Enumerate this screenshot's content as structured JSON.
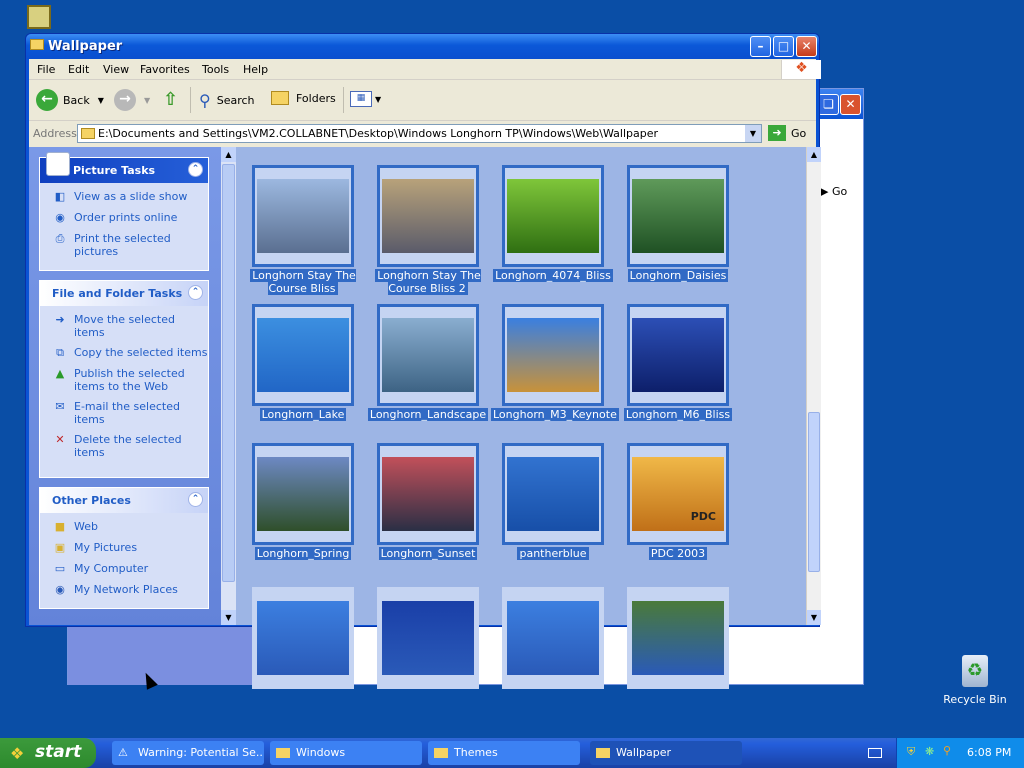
{
  "window": {
    "title": "Wallpaper"
  },
  "menu": [
    "File",
    "Edit",
    "View",
    "Favorites",
    "Tools",
    "Help"
  ],
  "toolbar": {
    "back": "Back",
    "search": "Search",
    "folders": "Folders"
  },
  "address": {
    "label": "Address",
    "value": "E:\\Documents and Settings\\VM2.COLLABNET\\Desktop\\Windows Longhorn TP\\Windows\\Web\\Wallpaper",
    "go": "Go"
  },
  "picture_tasks": {
    "title": "Picture Tasks",
    "items": [
      "View as a slide show",
      "Order prints online",
      "Print the selected pictures"
    ]
  },
  "file_tasks": {
    "title": "File and Folder Tasks",
    "items": [
      "Move the selected items",
      "Copy the selected items",
      "Publish the selected items to the Web",
      "E-mail the selected items",
      "Delete the selected items"
    ]
  },
  "other_places": {
    "title": "Other Places",
    "items": [
      "Web",
      "My Pictures",
      "My Computer",
      "My Network Places"
    ]
  },
  "files": [
    {
      "name": "Longhorn Stay The Course Bliss",
      "colors": [
        "#9cb8e0",
        "#5a6f90"
      ]
    },
    {
      "name": "Longhorn Stay The Course Bliss 2",
      "colors": [
        "#b8a27a",
        "#5a5b6a"
      ]
    },
    {
      "name": "Longhorn_4074_Bliss",
      "colors": [
        "#7fc63a",
        "#2f6f12"
      ]
    },
    {
      "name": "Longhorn_Daisies",
      "colors": [
        "#5f9a5a",
        "#1f5124"
      ]
    },
    {
      "name": "Longhorn_Lake",
      "colors": [
        "#3c8fe0",
        "#2166c6"
      ]
    },
    {
      "name": "Longhorn_Landscape",
      "colors": [
        "#8aaed0",
        "#3d6384"
      ]
    },
    {
      "name": "Longhorn_M3_Keynote",
      "colors": [
        "#3a7fe0",
        "#c8923a"
      ]
    },
    {
      "name": "Longhorn_M6_Bliss",
      "colors": [
        "#2c4fb6",
        "#0d1f6a"
      ]
    },
    {
      "name": "Longhorn_Spring",
      "colors": [
        "#6d89c3",
        "#2f4f2a"
      ]
    },
    {
      "name": "Longhorn_Sunset",
      "colors": [
        "#c2505a",
        "#2a2f45"
      ]
    },
    {
      "name": "pantherblue",
      "colors": [
        "#3273d0",
        "#174fa8"
      ]
    },
    {
      "name": "PDC 2003",
      "colors": [
        "#f0b848",
        "#c07018"
      ]
    }
  ],
  "pdc_label": "PDC",
  "desktop": {
    "recycle_bin": "Recycle Bin"
  },
  "taskbar": {
    "start": "start",
    "buttons": [
      "Warning: Potential Se...",
      "Windows",
      "Themes",
      "Wallpaper"
    ],
    "time": "6:08 PM"
  }
}
